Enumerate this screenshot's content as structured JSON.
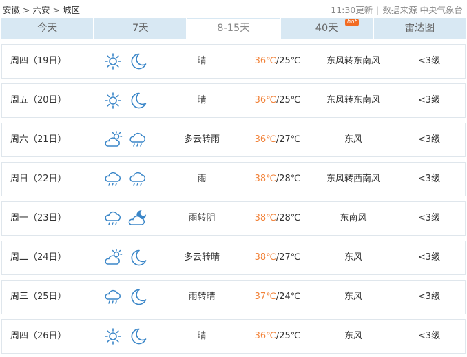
{
  "breadcrumb": {
    "province": "安徽",
    "city": "六安",
    "district": "城区",
    "sep": ">"
  },
  "source": {
    "update_time": "11:30更新",
    "divider": "|",
    "label": "数据来源 中央气象台"
  },
  "tabs": [
    {
      "label": "今天"
    },
    {
      "label": "7天"
    },
    {
      "label": "8-15天",
      "active": true
    },
    {
      "label": "40天",
      "badge": "hot"
    },
    {
      "label": "雷达图"
    }
  ],
  "colors": {
    "tab_bg": "#d8e8f3",
    "high_temp": "#f2833a",
    "hot_badge": "#f26b22",
    "icon": "#3a86c8"
  },
  "forecast": [
    {
      "day": "周四（19日）",
      "day_icon": "sun-icon",
      "night_icon": "moon-icon",
      "condition": "晴",
      "high": "36℃",
      "low": "/25℃",
      "wind": "东风转东南风",
      "level": "<3级"
    },
    {
      "day": "周五（20日）",
      "day_icon": "sun-icon",
      "night_icon": "moon-icon",
      "condition": "晴",
      "high": "36℃",
      "low": "/25℃",
      "wind": "东风转东南风",
      "level": "<3级"
    },
    {
      "day": "周六（21日）",
      "day_icon": "partly-cloudy-icon",
      "night_icon": "rain-cloud-icon",
      "condition": "多云转雨",
      "high": "36℃",
      "low": "/27℃",
      "wind": "东风",
      "level": "<3级"
    },
    {
      "day": "周日（22日）",
      "day_icon": "rain-cloud-icon",
      "night_icon": "rain-cloud-icon",
      "condition": "雨",
      "high": "38℃",
      "low": "/28℃",
      "wind": "东风转西南风",
      "level": "<3级"
    },
    {
      "day": "周一（23日）",
      "day_icon": "rain-cloud-icon",
      "night_icon": "cloudy-night-icon",
      "condition": "雨转阴",
      "high": "38℃",
      "low": "/28℃",
      "wind": "东南风",
      "level": "<3级"
    },
    {
      "day": "周二（24日）",
      "day_icon": "partly-cloudy-icon",
      "night_icon": "moon-icon",
      "condition": "多云转晴",
      "high": "38℃",
      "low": "/27℃",
      "wind": "东风",
      "level": "<3级"
    },
    {
      "day": "周三（25日）",
      "day_icon": "rain-cloud-icon",
      "night_icon": "moon-icon",
      "condition": "雨转晴",
      "high": "37℃",
      "low": "/24℃",
      "wind": "东风",
      "level": "<3级"
    },
    {
      "day": "周四（26日）",
      "day_icon": "sun-icon",
      "night_icon": "moon-icon",
      "condition": "晴",
      "high": "36℃",
      "low": "/25℃",
      "wind": "东风",
      "level": "<3级"
    }
  ]
}
